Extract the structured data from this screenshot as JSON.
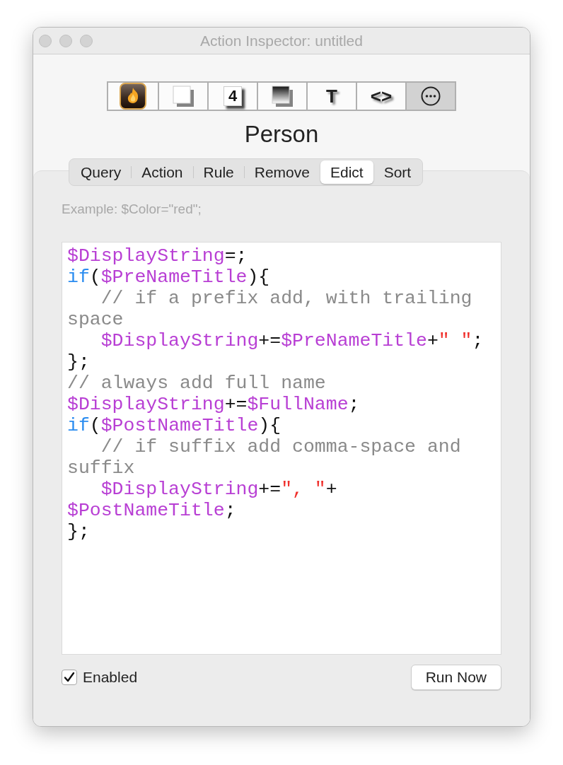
{
  "window": {
    "title": "Action Inspector: untitled"
  },
  "toolbar": [
    {
      "kind": "app",
      "selected": false
    },
    {
      "kind": "page",
      "selected": false
    },
    {
      "kind": "number",
      "glyph": "4",
      "selected": false
    },
    {
      "kind": "gradient",
      "selected": false
    },
    {
      "kind": "glyph",
      "glyph": "T",
      "selected": false
    },
    {
      "kind": "glyph",
      "glyph": "<>",
      "selected": false
    },
    {
      "kind": "more",
      "selected": true
    }
  ],
  "heading": "Person",
  "tabs": [
    {
      "label": "Query",
      "selected": false
    },
    {
      "label": "Action",
      "selected": false
    },
    {
      "label": "Rule",
      "selected": false
    },
    {
      "label": "Remove",
      "selected": false
    },
    {
      "label": "Edict",
      "selected": true
    },
    {
      "label": "Sort",
      "selected": false
    }
  ],
  "example": "Example: $Color=\"red\";",
  "code_lines": [
    [
      {
        "kind": "var",
        "text": "$DisplayString"
      },
      {
        "kind": "plain",
        "text": "=;"
      }
    ],
    [
      {
        "kind": "keyword",
        "text": "if"
      },
      {
        "kind": "plain",
        "text": "("
      },
      {
        "kind": "var",
        "text": "$PreNameTitle"
      },
      {
        "kind": "plain",
        "text": "){"
      }
    ],
    {
      "indent": true,
      "tokens": [
        {
          "kind": "comment",
          "text": "// if a prefix add, with trailing"
        }
      ]
    },
    [
      {
        "kind": "comment",
        "text": "space"
      }
    ],
    {
      "indent": true,
      "tokens": [
        {
          "kind": "var",
          "text": "$DisplayString"
        },
        {
          "kind": "plain",
          "text": "+="
        },
        {
          "kind": "var",
          "text": "$PreNameTitle"
        },
        {
          "kind": "plain",
          "text": "+"
        },
        {
          "kind": "string",
          "text": "\" \""
        },
        {
          "kind": "plain",
          "text": ";"
        }
      ]
    },
    [
      {
        "kind": "plain",
        "text": "};"
      }
    ],
    [
      {
        "kind": "comment",
        "text": "// always add full name"
      }
    ],
    [
      {
        "kind": "var",
        "text": "$DisplayString"
      },
      {
        "kind": "plain",
        "text": "+="
      },
      {
        "kind": "var",
        "text": "$FullName"
      },
      {
        "kind": "plain",
        "text": ";"
      }
    ],
    [
      {
        "kind": "keyword",
        "text": "if"
      },
      {
        "kind": "plain",
        "text": "("
      },
      {
        "kind": "var",
        "text": "$PostNameTitle"
      },
      {
        "kind": "plain",
        "text": "){"
      }
    ],
    {
      "indent": true,
      "tokens": [
        {
          "kind": "comment",
          "text": "// if suffix add comma-space and"
        }
      ]
    },
    [
      {
        "kind": "comment",
        "text": "suffix"
      }
    ],
    {
      "indent": true,
      "tokens": [
        {
          "kind": "var",
          "text": "$DisplayString"
        },
        {
          "kind": "plain",
          "text": "+="
        },
        {
          "kind": "string",
          "text": "\", \""
        },
        {
          "kind": "plain",
          "text": "+"
        }
      ]
    },
    [
      {
        "kind": "var",
        "text": "$PostNameTitle"
      },
      {
        "kind": "plain",
        "text": ";"
      }
    ],
    [
      {
        "kind": "plain",
        "text": "};"
      }
    ]
  ],
  "enabled": {
    "label": "Enabled",
    "checked": true
  },
  "run_button": "Run Now"
}
